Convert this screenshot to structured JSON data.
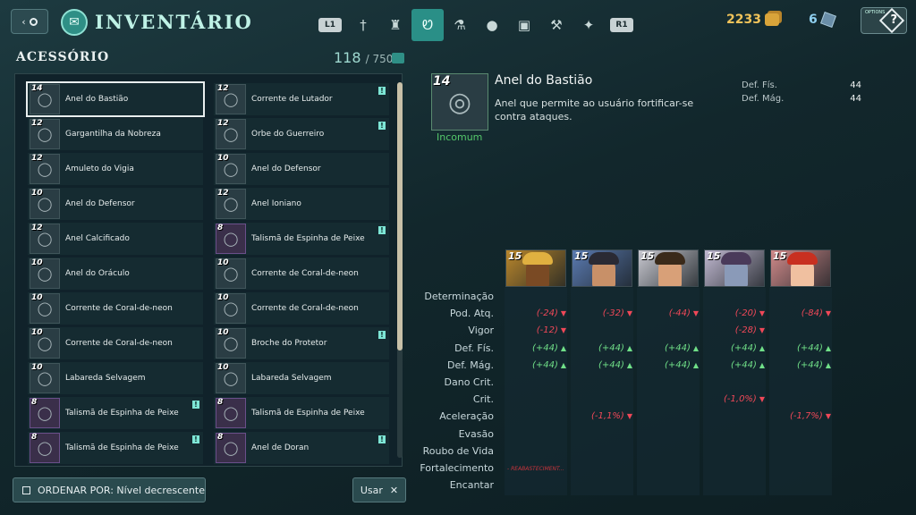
{
  "header": {
    "title": "Inventário",
    "left_trigger": "L1",
    "right_trigger": "R1",
    "gold": "2233",
    "gems": "6",
    "options_label": "OPTIONS",
    "help_glyph": "?"
  },
  "category_tabs": [
    {
      "icon": "sword-icon",
      "glyph": "†",
      "active": false
    },
    {
      "icon": "armor-icon",
      "glyph": "♜",
      "active": false
    },
    {
      "icon": "accessory-icon",
      "glyph": "Ꮼ",
      "active": true
    },
    {
      "icon": "potion-icon",
      "glyph": "⚗",
      "active": false
    },
    {
      "icon": "bomb-icon",
      "glyph": "●",
      "active": false
    },
    {
      "icon": "chest-icon",
      "glyph": "▣",
      "active": false
    },
    {
      "icon": "hammer-icon",
      "glyph": "⚒",
      "active": false
    },
    {
      "icon": "star-icon",
      "glyph": "✦",
      "active": false
    }
  ],
  "section": {
    "title": "Acessório",
    "count_current": "118",
    "count_total": "/ 750"
  },
  "items_left": [
    {
      "level": "14",
      "name": "Anel do Bastião",
      "new": false,
      "selected": true
    },
    {
      "level": "12",
      "name": "Gargantilha da Nobreza",
      "new": false
    },
    {
      "level": "12",
      "name": "Amuleto do Vigia",
      "new": false
    },
    {
      "level": "10",
      "name": "Anel do Defensor",
      "new": false
    },
    {
      "level": "12",
      "name": "Anel Calcificado",
      "new": false
    },
    {
      "level": "10",
      "name": "Anel do Oráculo",
      "new": false
    },
    {
      "level": "10",
      "name": "Corrente de Coral-de-neon",
      "new": false
    },
    {
      "level": "10",
      "name": "Corrente de Coral-de-neon",
      "new": false
    },
    {
      "level": "10",
      "name": "Labareda Selvagem",
      "new": false
    },
    {
      "level": "8",
      "name": "Talismã de Espinha de Peixe",
      "new": true
    },
    {
      "level": "8",
      "name": "Talismã de Espinha de Peixe",
      "new": true
    }
  ],
  "items_right": [
    {
      "level": "12",
      "name": "Corrente de Lutador",
      "new": true
    },
    {
      "level": "12",
      "name": "Orbe do Guerreiro",
      "new": true
    },
    {
      "level": "10",
      "name": "Anel do Defensor",
      "new": false
    },
    {
      "level": "12",
      "name": "Anel Ioniano",
      "new": false
    },
    {
      "level": "8",
      "name": "Talismã de Espinha de Peixe",
      "new": true
    },
    {
      "level": "10",
      "name": "Corrente de Coral-de-neon",
      "new": false
    },
    {
      "level": "10",
      "name": "Corrente de Coral-de-neon",
      "new": false
    },
    {
      "level": "10",
      "name": "Broche do Protetor",
      "new": true
    },
    {
      "level": "10",
      "name": "Labareda Selvagem",
      "new": false
    },
    {
      "level": "8",
      "name": "Talismã de Espinha de Peixe",
      "new": false
    },
    {
      "level": "8",
      "name": "Anel de Doran",
      "new": true
    }
  ],
  "footer": {
    "sort_label": "ORDENAR POR: Nível decrescente",
    "use_label": "Usar",
    "use_glyph": "✕"
  },
  "detail": {
    "level": "14",
    "name": "Anel do Bastião",
    "description": "Anel que permite ao usuário fortificar-se contra ataques.",
    "rarity": "Incomum",
    "stats": [
      {
        "label": "Def. Fís.",
        "value": "44"
      },
      {
        "label": "Def. Mág.",
        "value": "44"
      }
    ]
  },
  "champions": [
    {
      "level": "15",
      "bg": "#b8862c",
      "skin": "#7a4a24",
      "hair": "#e0b040"
    },
    {
      "level": "15",
      "bg": "#5a7ab0",
      "skin": "#c89068",
      "hair": "#2a2a34"
    },
    {
      "level": "15",
      "bg": "#c8c8d0",
      "skin": "#d8a078",
      "hair": "#3a2a1a"
    },
    {
      "level": "15",
      "bg": "#c0b8d0",
      "skin": "#8a9ab8",
      "hair": "#4a3a5a"
    },
    {
      "level": "15",
      "bg": "#d08a8a",
      "skin": "#f0c0a0",
      "hair": "#c83020"
    }
  ],
  "stat_labels": [
    "Determinação",
    "Pod. Atq.",
    "Vigor",
    "Def. Fís.",
    "Def. Mág.",
    "Dano Crit.",
    "Crit.",
    "Aceleração",
    "Evasão",
    "Roubo de Vida",
    "Fortalecimento",
    "Encantar"
  ],
  "comparison": [
    {
      "row": 1,
      "col": 0,
      "text": "(-24)",
      "dir": "down"
    },
    {
      "row": 1,
      "col": 1,
      "text": "(-32)",
      "dir": "down"
    },
    {
      "row": 1,
      "col": 2,
      "text": "(-44)",
      "dir": "down"
    },
    {
      "row": 1,
      "col": 3,
      "text": "(-20)",
      "dir": "down"
    },
    {
      "row": 1,
      "col": 4,
      "text": "(-84)",
      "dir": "down"
    },
    {
      "row": 2,
      "col": 0,
      "text": "(-12)",
      "dir": "down"
    },
    {
      "row": 2,
      "col": 3,
      "text": "(-28)",
      "dir": "down"
    },
    {
      "row": 3,
      "col": 0,
      "text": "(+44)",
      "dir": "up"
    },
    {
      "row": 3,
      "col": 1,
      "text": "(+44)",
      "dir": "up"
    },
    {
      "row": 3,
      "col": 2,
      "text": "(+44)",
      "dir": "up"
    },
    {
      "row": 3,
      "col": 3,
      "text": "(+44)",
      "dir": "up"
    },
    {
      "row": 3,
      "col": 4,
      "text": "(+44)",
      "dir": "up"
    },
    {
      "row": 4,
      "col": 0,
      "text": "(+44)",
      "dir": "up"
    },
    {
      "row": 4,
      "col": 1,
      "text": "(+44)",
      "dir": "up"
    },
    {
      "row": 4,
      "col": 2,
      "text": "(+44)",
      "dir": "up"
    },
    {
      "row": 4,
      "col": 3,
      "text": "(+44)",
      "dir": "up"
    },
    {
      "row": 4,
      "col": 4,
      "text": "(+44)",
      "dir": "up"
    },
    {
      "row": 6,
      "col": 3,
      "text": "(-1,0%)",
      "dir": "down"
    },
    {
      "row": 7,
      "col": 1,
      "text": "(-1,1%)",
      "dir": "down"
    },
    {
      "row": 7,
      "col": 4,
      "text": "(-1,7%)",
      "dir": "down"
    },
    {
      "row": 10,
      "col": 0,
      "text": "- REABASTECIMENT...",
      "dir": "warn"
    }
  ]
}
